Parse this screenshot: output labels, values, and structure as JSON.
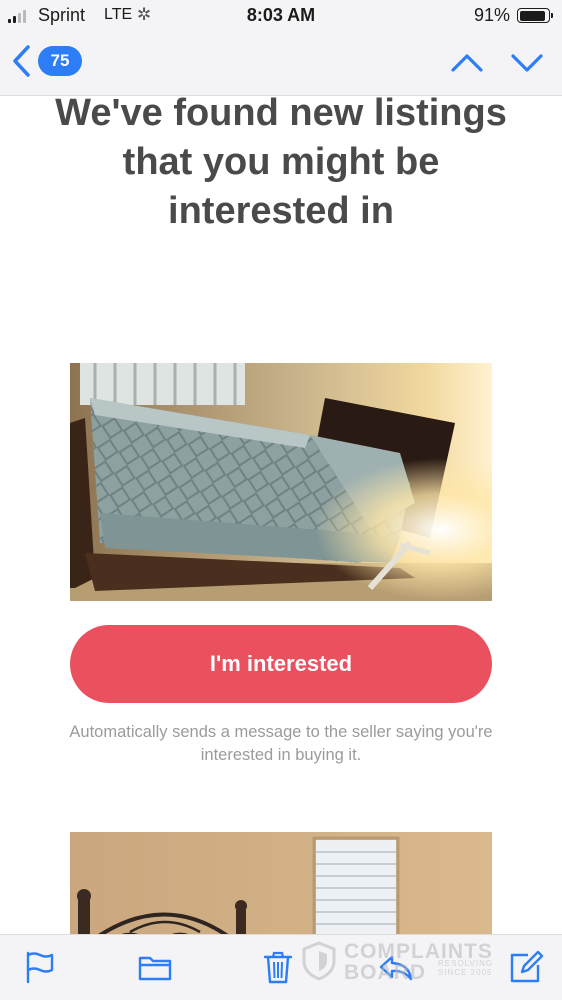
{
  "status_bar": {
    "carrier": "Sprint",
    "network": "LTE",
    "time": "8:03 AM",
    "battery": "91%",
    "battery_level": 0.91,
    "signal_bars": 2
  },
  "nav": {
    "unread_count": "75",
    "icons": {
      "back": "chevron-left-icon",
      "previous": "chevron-up-icon",
      "next": "chevron-down-icon"
    },
    "accent_color": "#2c7df6"
  },
  "email": {
    "headline": "We've found new listings that you might be interested in",
    "listings": [
      {
        "photo": "bed-with-quilt-photo",
        "button_label": "I'm interested",
        "helper_text": "Automatically sends a message to the seller saying you're interested in buying it."
      },
      {
        "photo": "wrought-iron-bed-photo"
      }
    ],
    "button_color": "#ea505e"
  },
  "toolbar": {
    "icons": [
      "flag-icon",
      "folder-icon",
      "trash-icon",
      "reply-icon",
      "compose-icon"
    ]
  },
  "watermark": {
    "line1": "COMPLAINTS",
    "line2": "BOARD",
    "tagline": "RESOLVING SINCE 2005"
  }
}
